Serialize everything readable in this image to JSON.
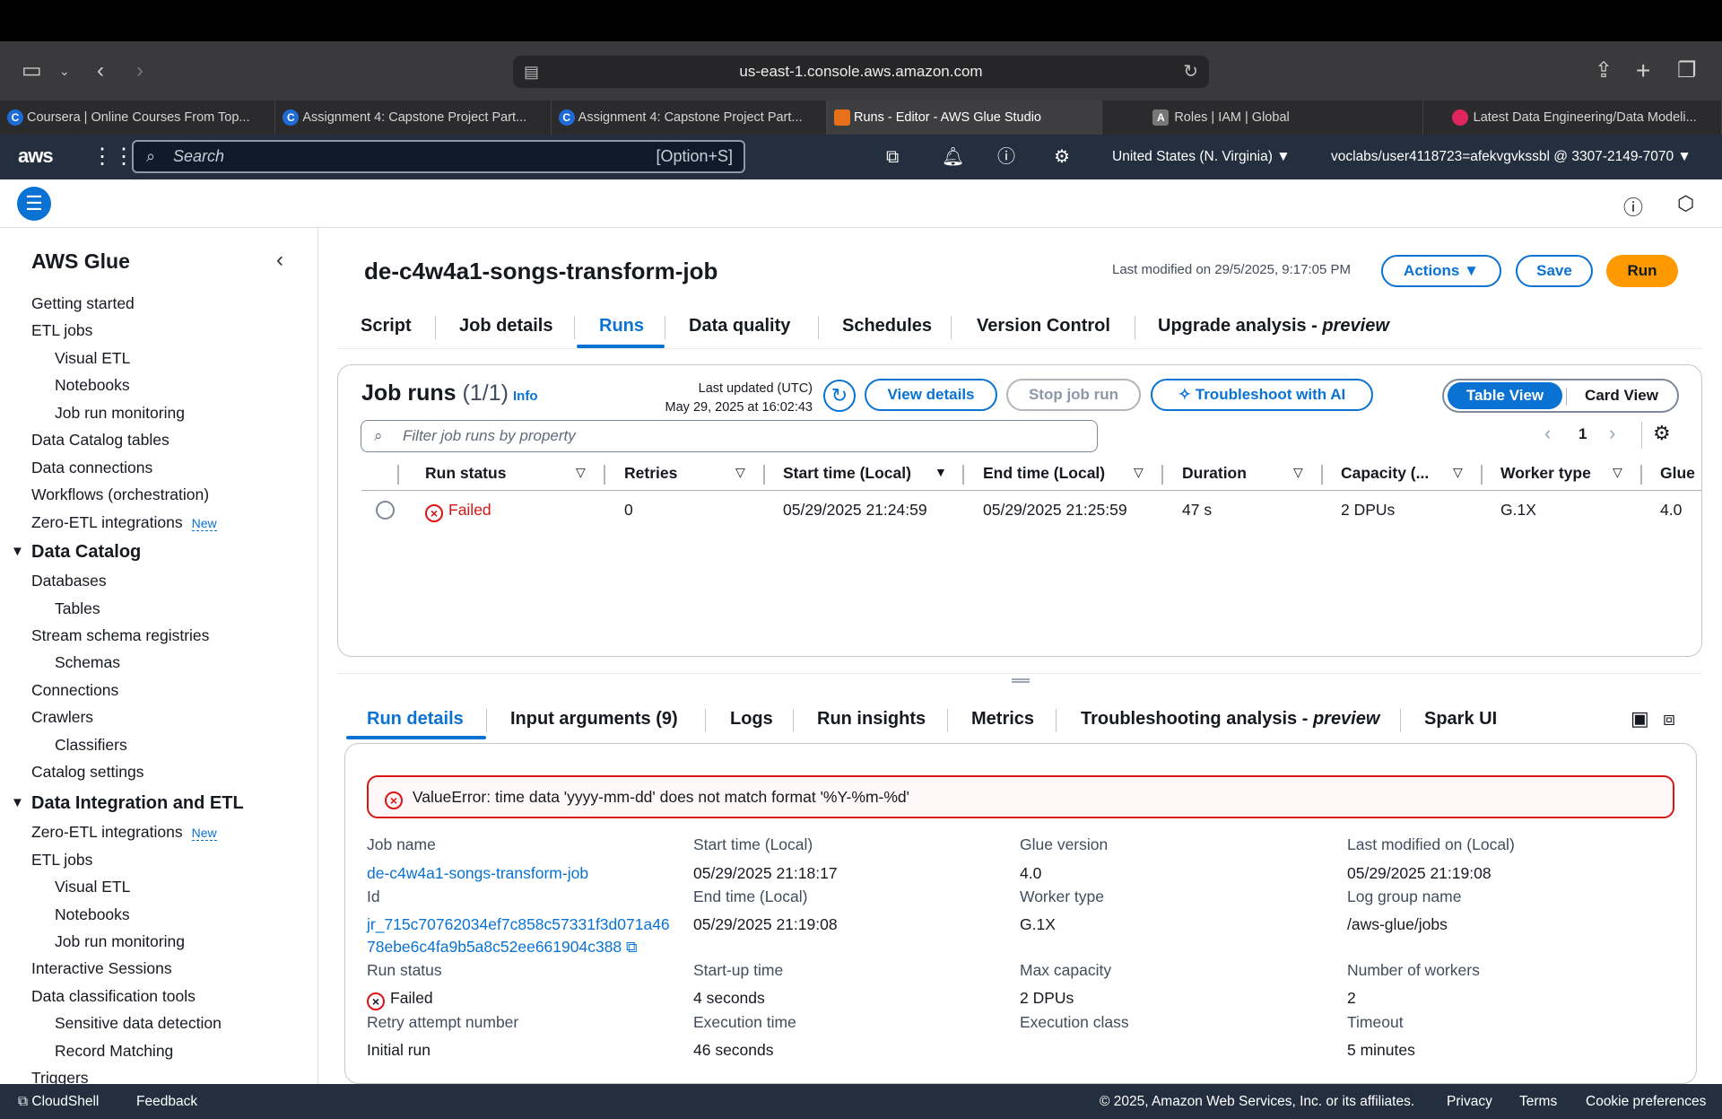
{
  "browser": {
    "url": "us-east-1.console.aws.amazon.com",
    "tabs": [
      {
        "label": "Coursera | Online Courses From Top...",
        "icon": "C"
      },
      {
        "label": "Assignment 4: Capstone Project Part...",
        "icon": "C"
      },
      {
        "label": "Assignment 4: Capstone Project Part...",
        "icon": "C"
      },
      {
        "label": "Runs - Editor - AWS Glue Studio",
        "icon": "glue"
      },
      {
        "label": "Roles | IAM | Global",
        "icon": "A"
      },
      {
        "label": "Latest Data Engineering/Data Modeli...",
        "icon": "coursera-red"
      }
    ]
  },
  "awsnav": {
    "logo": "aws",
    "search_placeholder": "Search",
    "search_shortcut": "[Option+S]",
    "region": "United States (N. Virginia) ▼",
    "account": "voclabs/user4118723=afekvgvkssbl @ 3307-2149-7070 ▼"
  },
  "sidebar": {
    "title": "AWS Glue",
    "items": [
      {
        "label": "Getting started"
      },
      {
        "label": "ETL jobs"
      },
      {
        "label": "Visual ETL"
      },
      {
        "label": "Notebooks"
      },
      {
        "label": "Job run monitoring"
      },
      {
        "label": "Data Catalog tables"
      },
      {
        "label": "Data connections"
      },
      {
        "label": "Workflows (orchestration)"
      },
      {
        "label": "Zero-ETL integrations",
        "badge": "New"
      },
      {
        "label": "Data Catalog",
        "heading": true
      },
      {
        "label": "Databases"
      },
      {
        "label": "Tables"
      },
      {
        "label": "Stream schema registries"
      },
      {
        "label": "Schemas"
      },
      {
        "label": "Connections"
      },
      {
        "label": "Crawlers"
      },
      {
        "label": "Classifiers"
      },
      {
        "label": "Catalog settings"
      },
      {
        "label": "Data Integration and ETL",
        "heading": true
      },
      {
        "label": "Zero-ETL integrations",
        "badge": "New"
      },
      {
        "label": "ETL jobs"
      },
      {
        "label": "Visual ETL"
      },
      {
        "label": "Notebooks"
      },
      {
        "label": "Job run monitoring"
      },
      {
        "label": "Interactive Sessions"
      },
      {
        "label": "Data classification tools"
      },
      {
        "label": "Sensitive data detection"
      },
      {
        "label": "Record Matching"
      },
      {
        "label": "Triggers"
      }
    ]
  },
  "job": {
    "title": "de-c4w4a1-songs-transform-job",
    "last_modified": "Last modified on 29/5/2025, 9:17:05 PM",
    "actions_label": "Actions",
    "save_label": "Save",
    "run_label": "Run",
    "tabs": [
      "Script",
      "Job details",
      "Runs",
      "Data quality",
      "Schedules",
      "Version Control",
      "Upgrade analysis - "
    ],
    "tab_preview": "preview"
  },
  "runs": {
    "title": "Job runs",
    "count": "(1/1)",
    "info": "Info",
    "last_updated_label": "Last updated (UTC)",
    "last_updated_value": "May 29, 2025 at 16:02:43",
    "view_details": "View details",
    "stop_job_run": "Stop job run",
    "troubleshoot": "Troubleshoot with AI",
    "table_view": "Table View",
    "card_view": "Card View",
    "filter_placeholder": "Filter job runs by property",
    "page": "1",
    "columns": [
      "Run status",
      "Retries",
      "Start time (Local)",
      "End time (Local)",
      "Duration",
      "Capacity (...",
      "Worker type",
      "Glue v"
    ],
    "rows": [
      {
        "status": "Failed",
        "retries": "0",
        "start": "05/29/2025 21:24:59",
        "end": "05/29/2025 21:25:59",
        "duration": "47 s",
        "capacity": "2 DPUs",
        "worker": "G.1X",
        "glue": "4.0"
      }
    ]
  },
  "details": {
    "tabs": [
      "Run details",
      "Input arguments (9)",
      "Logs",
      "Run insights",
      "Metrics",
      "Troubleshooting analysis - ",
      "Spark UI"
    ],
    "tab_preview": "preview",
    "error": "ValueError: time data 'yyyy-mm-dd' does not match format '%Y-%m-%d'",
    "job_name_label": "Job name",
    "job_name": "de-c4w4a1-songs-transform-job",
    "id_label": "Id",
    "id_line1": "jr_715c70762034ef7c858c57331f3d071a46",
    "id_line2": "78ebe6c4fa9b5a8c52ee661904c388",
    "run_status_label": "Run status",
    "run_status": "Failed",
    "retry_label": "Retry attempt number",
    "retry_value": "Initial run",
    "start_label": "Start time (Local)",
    "start_value": "05/29/2025 21:18:17",
    "end_label": "End time (Local)",
    "end_value": "05/29/2025 21:19:08",
    "startup_label": "Start-up time",
    "startup_value": "4 seconds",
    "exec_label": "Execution time",
    "exec_value": "46 seconds",
    "glue_label": "Glue version",
    "glue_value": "4.0",
    "worker_label": "Worker type",
    "worker_value": "G.1X",
    "maxcap_label": "Max capacity",
    "maxcap_value": "2 DPUs",
    "execclass_label": "Execution class",
    "lastmod_label": "Last modified on (Local)",
    "lastmod_value": "05/29/2025 21:19:08",
    "loggroup_label": "Log group name",
    "loggroup_value": "/aws-glue/jobs",
    "workers_label": "Number of workers",
    "workers_value": "2",
    "timeout_label": "Timeout",
    "timeout_value": "5 minutes"
  },
  "footer": {
    "cloudshell": "CloudShell",
    "feedback": "Feedback",
    "copyright": "© 2025, Amazon Web Services, Inc. or its affiliates.",
    "privacy": "Privacy",
    "terms": "Terms",
    "cookies": "Cookie preferences"
  },
  "colors": {
    "accent": "#0972d3",
    "run": "#ff9900",
    "error": "#d91515",
    "nav": "#232f3e"
  }
}
